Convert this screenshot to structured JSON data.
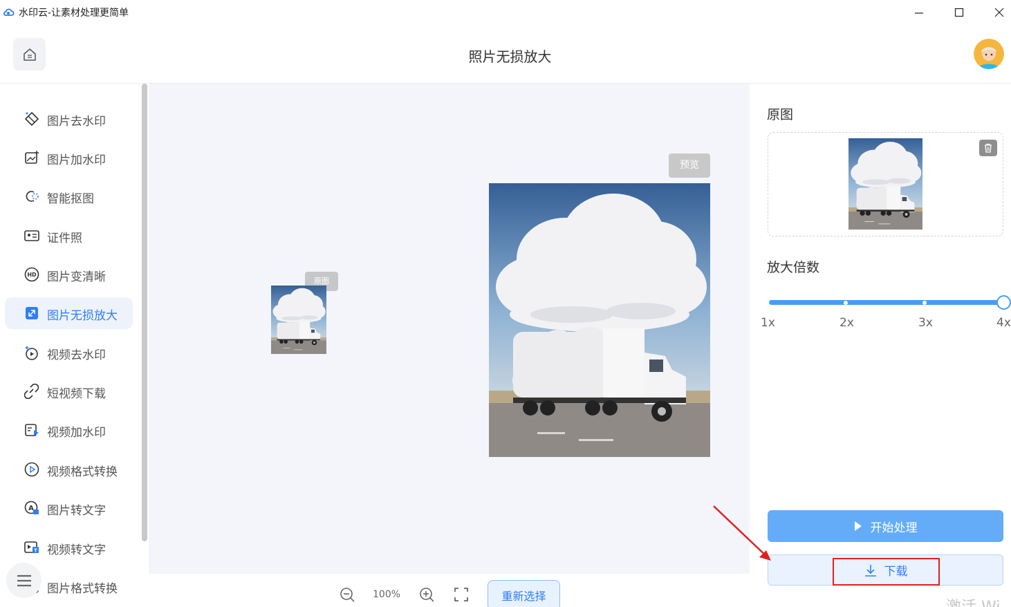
{
  "window": {
    "title": "水印云-让素材处理更简单"
  },
  "header": {
    "title": "照片无损放大"
  },
  "sidebar": {
    "items": [
      {
        "label": "图片去水印",
        "icon": "eraser-icon"
      },
      {
        "label": "图片加水印",
        "icon": "image-add-icon"
      },
      {
        "label": "智能抠图",
        "icon": "cutout-icon"
      },
      {
        "label": "证件照",
        "icon": "id-card-icon"
      },
      {
        "label": "图片变清晰",
        "icon": "hd-icon"
      },
      {
        "label": "图片无损放大",
        "icon": "enlarge-icon",
        "active": true
      },
      {
        "label": "视频去水印",
        "icon": "video-eraser-icon"
      },
      {
        "label": "短视频下载",
        "icon": "link-icon"
      },
      {
        "label": "视频加水印",
        "icon": "video-add-icon"
      },
      {
        "label": "视频格式转换",
        "icon": "play-circle-icon"
      },
      {
        "label": "图片转文字",
        "icon": "image-text-icon"
      },
      {
        "label": "视频转文字",
        "icon": "video-text-icon"
      },
      {
        "label": "图片格式转换",
        "icon": "format-icon"
      }
    ]
  },
  "canvas": {
    "original_tag": "原图",
    "preview_tag": "预览",
    "zoom": "100%",
    "reselect_label": "重新选择"
  },
  "panel": {
    "original_heading": "原图",
    "scale_heading": "放大倍数",
    "scale_ticks": [
      "1x",
      "2x",
      "3x",
      "4x"
    ],
    "scale_selected": "4x",
    "start_label": "开始处理",
    "download_label": "下载"
  },
  "overlay": {
    "watermark": "激活 Wi"
  },
  "colors": {
    "accent": "#2f7ff6",
    "slider": "#4a9bf4",
    "annotation": "#e02020"
  }
}
